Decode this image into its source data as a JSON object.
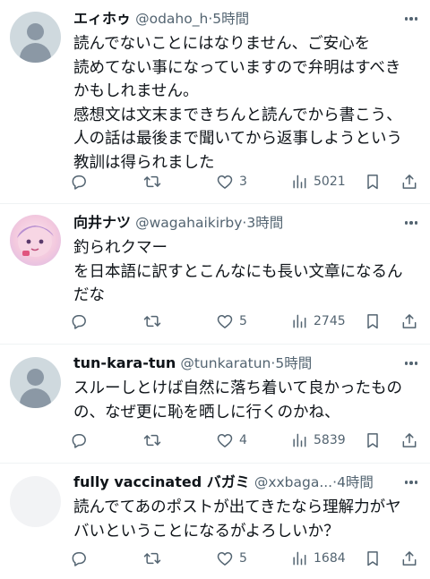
{
  "tweets": [
    {
      "name": "エィホゥ",
      "handle": "@odaho_h",
      "separator": "·",
      "time": "5時間",
      "lines": [
        "読んでないことにはなりません、ご安心を",
        "読めてない事になっていますので弁明はすべき",
        "かもしれません。",
        "感想文は文末まできちんと読んでから書こう、",
        "人の話は最後まで聞いてから返事しようという",
        "教訓は得られました"
      ],
      "replies": "",
      "retweets": "",
      "likes": "3",
      "views": "5021",
      "avatar": "default"
    },
    {
      "name": "向井ナツ",
      "handle": "@wagahaikirby",
      "separator": "·",
      "time": "3時間",
      "lines": [
        "釣られクマー",
        "を日本語に訳すとこんなにも長い文章になるん",
        "だな"
      ],
      "replies": "",
      "retweets": "",
      "likes": "5",
      "views": "2745",
      "avatar": "art"
    },
    {
      "name": "tun-kara-tun",
      "handle": "@tunkaratun",
      "separator": "·",
      "time": "5時間",
      "lines": [
        "スルーしとけば自然に落ち着いて良かったもの",
        "の、なぜ更に恥を晒しに行くのかね、"
      ],
      "replies": "",
      "retweets": "",
      "likes": "4",
      "views": "5839",
      "avatar": "default"
    },
    {
      "name": "fully vaccinated バガミ",
      "handle": "@xxbaga...",
      "separator": "·",
      "time": "4時間",
      "lines": [
        "読んでてあのポストが出てきたなら理解力がヤ",
        "バいということになるがよろしいか？"
      ],
      "replies": "",
      "retweets": "",
      "likes": "5",
      "views": "1684",
      "avatar": "blank"
    }
  ],
  "colors": {
    "text": "#0f1419",
    "secondary": "#536471",
    "divider": "#eff3f4",
    "avatar_default": "#cfd9de"
  },
  "icons": [
    "reply-icon",
    "retweet-icon",
    "like-icon",
    "views-icon",
    "bookmark-icon",
    "share-icon",
    "more-icon"
  ]
}
